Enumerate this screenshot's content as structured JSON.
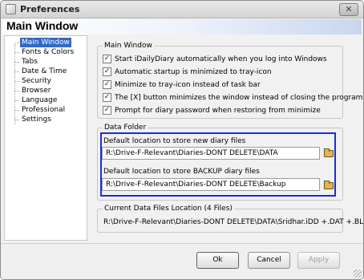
{
  "window": {
    "title": "Preferences",
    "close_label": "✕",
    "heading": "Main Window"
  },
  "nav": {
    "items": [
      {
        "label": "Main Window",
        "selected": true
      },
      {
        "label": "Fonts & Colors"
      },
      {
        "label": "Tabs"
      },
      {
        "label": "Date & Time"
      },
      {
        "label": "Security"
      },
      {
        "label": "Browser"
      },
      {
        "label": "Language"
      },
      {
        "label": "Professional"
      },
      {
        "label": "Settings"
      }
    ]
  },
  "main_window_group": {
    "title": "Main Window",
    "options": [
      {
        "label": "Start iDailyDiary automatically when you log into Windows",
        "checked": true
      },
      {
        "label": "Automatic startup is minimized to tray-icon",
        "checked": true
      },
      {
        "label": "Minimize to tray-icon instead of task bar",
        "checked": true
      },
      {
        "label": "The [X] button minimizes the window instead of closing the program",
        "checked": true
      },
      {
        "label": "Prompt for diary password when restoring from minimize",
        "checked": true
      }
    ]
  },
  "data_folder": {
    "title": "Data Folder",
    "new_label": "Default location to store new diary files",
    "new_path": "R:\\Drive-F-Relevant\\Diaries-DONT DELETE\\DATA",
    "backup_label": "Default location to store BACKUP diary files",
    "backup_path": "R:\\Drive-F-Relevant\\Diaries-DONT DELETE\\Backup",
    "browse_icon": "folder-open-icon"
  },
  "current_location": {
    "title": "Current Data Files Location (4 Files)",
    "path": "R:\\Drive-F-Relevant\\Diaries-DONT DELETE\\DATA\\Sridhar.iDD +.DAT +.BLB -"
  },
  "buttons": {
    "ok": "Ok",
    "cancel": "Cancel",
    "apply": "Apply"
  },
  "colors": {
    "selection": "#3169c6",
    "highlight_border": "#1a2fd0"
  }
}
